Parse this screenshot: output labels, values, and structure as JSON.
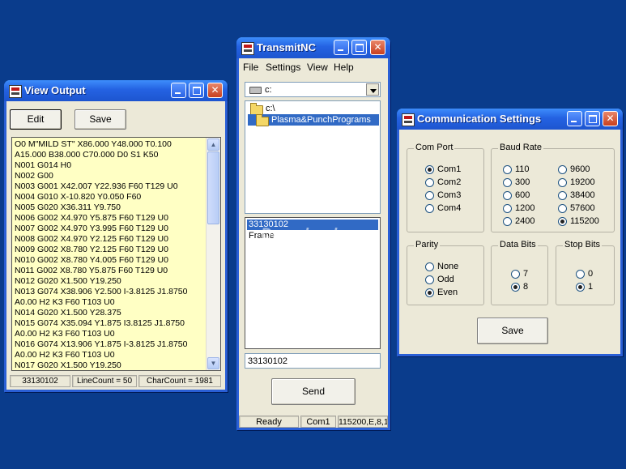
{
  "view_output": {
    "title": "View Output",
    "edit_label": "Edit",
    "save_label": "Save",
    "lines": [
      "O0 M\"MILD ST\" X86.000 Y48.000 T0.100",
      "A15.000 B38.000 C70.000 D0 S1 K50",
      "N001 G014 H0",
      "N002 G00",
      "N003 G001 X42.007 Y22.936 F60 T129 U0",
      "N004 G010 X-10.820 Y0.050 F60",
      "N005 G020 X36.311 Y9.750",
      "N006 G002 X4.970 Y5.875 F60 T129 U0",
      "N007 G002 X4.970 Y3.995 F60 T129 U0",
      "N008 G002 X4.970 Y2.125 F60 T129 U0",
      "N009 G002 X8.780 Y2.125 F60 T129 U0",
      "N010 G002 X8.780 Y4.005 F60 T129 U0",
      "N011 G002 X8.780 Y5.875 F60 T129 U0",
      "N012 G020 X1.500 Y19.250",
      "N013 G074 X38.906 Y2.500 I-3.8125 J1.8750",
      "A0.00 H2 K3 F60 T103 U0",
      "N014 G020 X1.500 Y28.375",
      "N015 G074 X35.094 Y1.875 I3.8125 J1.8750",
      "A0.00 H2 K3 F60 T103 U0",
      "N016 G074 X13.906 Y1.875 I-3.8125 J1.8750",
      "A0.00 H2 K3 F60 T103 U0",
      "N017 G020 X1.500 Y19.250"
    ],
    "status": {
      "file": "33130102",
      "line_count": "LineCount = 50",
      "char_count": "CharCount = 1981"
    }
  },
  "transmit": {
    "title": "TransmitNC",
    "menu": [
      "File",
      "Settings",
      "View",
      "Help"
    ],
    "drive": "c:",
    "folders": [
      "c:\\",
      "Plasma&PunchPrograms"
    ],
    "files": [
      "33130102",
      "Frame"
    ],
    "file_input": "33130102",
    "send_label": "Send",
    "status": {
      "state": "Ready",
      "port": "Com1",
      "params": "115200,E,8,1"
    }
  },
  "comm": {
    "title": "Communication Settings",
    "com_port": {
      "title": "Com Port",
      "options": [
        "Com1",
        "Com2",
        "Com3",
        "Com4"
      ],
      "selected": "Com1"
    },
    "baud": {
      "title": "Baud Rate",
      "options_left": [
        "110",
        "300",
        "600",
        "1200",
        "2400"
      ],
      "options_right": [
        "9600",
        "19200",
        "38400",
        "57600",
        "115200"
      ],
      "selected": "115200"
    },
    "parity": {
      "title": "Parity",
      "options": [
        "None",
        "Odd",
        "Even"
      ],
      "selected": "Even"
    },
    "data_bits": {
      "title": "Data Bits",
      "options": [
        "7",
        "8"
      ],
      "selected": "8"
    },
    "stop_bits": {
      "title": "Stop Bits",
      "options": [
        "0",
        "1"
      ],
      "selected": "1"
    },
    "save_label": "Save"
  },
  "watermark": "Download",
  "colors": {
    "desktop": "#0a3c8c",
    "titlebar": "#2462e2",
    "selection": "#316ac5",
    "output_background": "#ffffc4"
  }
}
